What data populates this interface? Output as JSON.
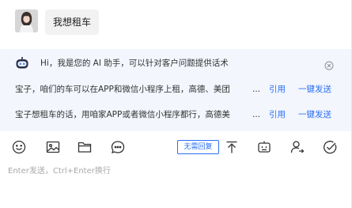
{
  "message": {
    "text": "我想租车"
  },
  "ai_panel": {
    "greeting": "Hi，我是您的 AI 助手，可以针对客户问题提供话术",
    "suggestions": [
      {
        "text": "宝子，咱们的车可以在APP和微信小程序上租，高德、美团",
        "quote_label": "引用",
        "send_label": "一键发送"
      },
      {
        "text": "宝子想租车的话，用咱家APP或者微信小程序都行，高德美",
        "quote_label": "引用",
        "send_label": "一键发送"
      }
    ]
  },
  "toolbar": {
    "no_reply_label": "无需回复",
    "icons": [
      "emoji-icon",
      "image-icon",
      "folder-icon",
      "chat-bubble-icon",
      "pin-top-icon",
      "bot-icon",
      "transfer-user-icon",
      "check-circle-icon"
    ]
  },
  "composer": {
    "placeholder": "Enter发送，Ctrl+Enter换行",
    "value": ""
  },
  "colors": {
    "accent": "#2b6ff3",
    "panel_bg": "#f3f6fd",
    "bubble_bg": "#f2f2f2"
  }
}
